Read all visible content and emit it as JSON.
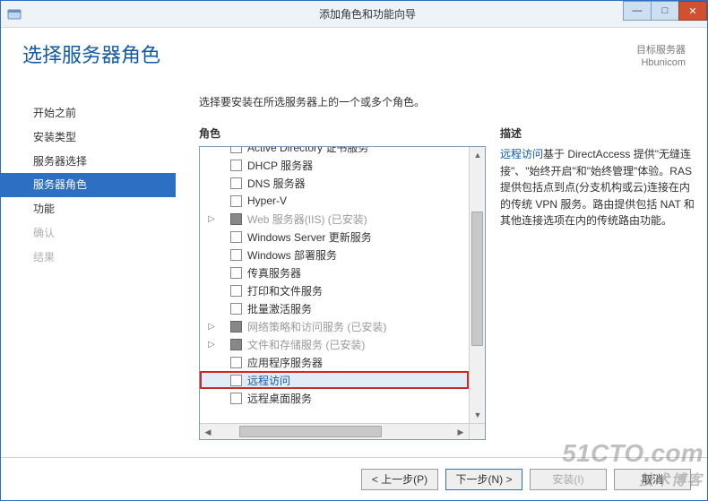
{
  "titlebar": {
    "title": "添加角色和功能向导",
    "icon_name": "wizard-icon"
  },
  "header": {
    "title": "选择服务器角色",
    "target_label": "目标服务器",
    "target_server": "Hbunicom"
  },
  "sidebar": {
    "items": [
      {
        "label": "开始之前",
        "state": "normal"
      },
      {
        "label": "安装类型",
        "state": "normal"
      },
      {
        "label": "服务器选择",
        "state": "normal"
      },
      {
        "label": "服务器角色",
        "state": "selected"
      },
      {
        "label": "功能",
        "state": "normal"
      },
      {
        "label": "确认",
        "state": "disabled"
      },
      {
        "label": "结果",
        "state": "disabled"
      }
    ]
  },
  "main": {
    "prompt": "选择要安装在所选服务器上的一个或多个角色。",
    "roles_heading": "角色",
    "desc_heading": "描述",
    "roles": [
      {
        "label": "Active Directory 证书服务",
        "checked": false,
        "has_children": false,
        "installed": false,
        "cutoff": true
      },
      {
        "label": "DHCP 服务器",
        "checked": false,
        "has_children": false,
        "installed": false
      },
      {
        "label": "DNS 服务器",
        "checked": false,
        "has_children": false,
        "installed": false
      },
      {
        "label": "Hyper-V",
        "checked": false,
        "has_children": false,
        "installed": false
      },
      {
        "label": "Web 服务器(IIS) (已安装)",
        "checked": "partial",
        "has_children": true,
        "installed": true
      },
      {
        "label": "Windows Server 更新服务",
        "checked": false,
        "has_children": false,
        "installed": false
      },
      {
        "label": "Windows 部署服务",
        "checked": false,
        "has_children": false,
        "installed": false
      },
      {
        "label": "传真服务器",
        "checked": false,
        "has_children": false,
        "installed": false
      },
      {
        "label": "打印和文件服务",
        "checked": false,
        "has_children": false,
        "installed": false
      },
      {
        "label": "批量激活服务",
        "checked": false,
        "has_children": false,
        "installed": false
      },
      {
        "label": "网络策略和访问服务 (已安装)",
        "checked": "partial",
        "has_children": true,
        "installed": true
      },
      {
        "label": "文件和存储服务 (已安装)",
        "checked": "partial",
        "has_children": true,
        "installed": true
      },
      {
        "label": "应用程序服务器",
        "checked": false,
        "has_children": false,
        "installed": false
      },
      {
        "label": "远程访问",
        "checked": false,
        "has_children": false,
        "installed": false,
        "selected": true
      },
      {
        "label": "远程桌面服务",
        "checked": false,
        "has_children": false,
        "installed": false
      }
    ],
    "description_hl": "远程访问",
    "description_rest": "基于 DirectAccess 提供\"无缝连接\"、\"始终开启\"和\"始终管理\"体验。RAS 提供包括点到点(分支机构或云)连接在内的传统 VPN 服务。路由提供包括 NAT 和其他连接选项在内的传统路由功能。"
  },
  "footer": {
    "prev": "< 上一步(P)",
    "next": "下一步(N) >",
    "install": "安装(I)",
    "cancel": "取消"
  },
  "watermark": {
    "line1": "51CTO.com",
    "line2": "技术博客"
  }
}
